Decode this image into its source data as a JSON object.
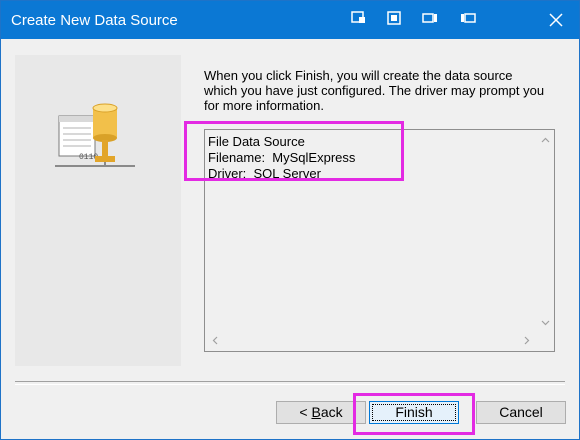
{
  "window": {
    "title": "Create New Data Source",
    "close_icon": "close-icon",
    "titlebar_color": "#0b78d4"
  },
  "wizard_image": {
    "icon": "odbc-data-source-icon"
  },
  "description": {
    "line1": "When you click Finish, you will create the data source",
    "line2": "which you have just configured.  The driver may prompt you",
    "line3": "for more information."
  },
  "summary": {
    "line1": "File Data Source",
    "line2": "Filename:  MySqlExpress",
    "line3": "Driver:  SQL Server"
  },
  "buttons": {
    "back_prefix": "< ",
    "back_mnemonic": "B",
    "back_rest": "ack",
    "finish": "Finish",
    "cancel": "Cancel"
  },
  "highlight_color": "#e32ae3"
}
